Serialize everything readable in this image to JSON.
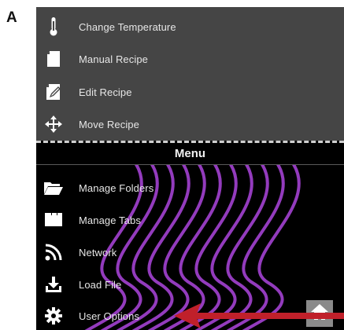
{
  "figure": {
    "panel_label": "A"
  },
  "top_items": [
    {
      "label": "Change Temperature",
      "icon": "thermometer-icon"
    },
    {
      "label": "Manual Recipe",
      "icon": "manual-recipe-icon"
    },
    {
      "label": "Edit Recipe",
      "icon": "edit-recipe-icon"
    },
    {
      "label": "Move Recipe",
      "icon": "move-arrows-icon"
    }
  ],
  "menu": {
    "title": "Menu",
    "items": [
      {
        "label": "Manage Folders",
        "icon": "folder-icon"
      },
      {
        "label": "Manage Tabs",
        "icon": "tabs-icon"
      },
      {
        "label": "Network",
        "icon": "network-icon"
      },
      {
        "label": "Load File",
        "icon": "load-file-icon"
      },
      {
        "label": "User Options",
        "icon": "gear-icon"
      }
    ]
  },
  "colors": {
    "top_bg": "#454545",
    "menu_bg": "#000000",
    "swirl": "#9b3fc8",
    "arrow": "#c0202a"
  }
}
